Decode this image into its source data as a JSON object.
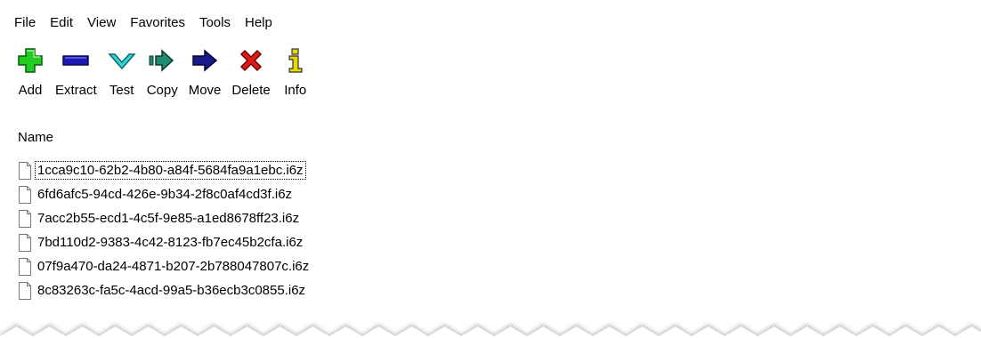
{
  "menu": {
    "items": [
      {
        "label": "File"
      },
      {
        "label": "Edit"
      },
      {
        "label": "View"
      },
      {
        "label": "Favorites"
      },
      {
        "label": "Tools"
      },
      {
        "label": "Help"
      }
    ]
  },
  "toolbar": {
    "add": {
      "label": "Add",
      "icon": "plus-icon",
      "color": "#22cc22"
    },
    "extract": {
      "label": "Extract",
      "icon": "minus-icon",
      "color": "#1a1ab0"
    },
    "test": {
      "label": "Test",
      "icon": "check-chevron-icon",
      "color": "#33d6d6"
    },
    "copy": {
      "label": "Copy",
      "icon": "double-arrow-right-icon",
      "color": "#1f8a6e"
    },
    "move": {
      "label": "Move",
      "icon": "arrow-right-icon",
      "color": "#1a1a8a"
    },
    "delete": {
      "label": "Delete",
      "icon": "x-icon",
      "color": "#e01818"
    },
    "info": {
      "label": "Info",
      "icon": "info-icon",
      "color": "#e6d800"
    }
  },
  "list": {
    "header": "Name",
    "files": [
      "1cca9c10-62b2-4b80-a84f-5684fa9a1ebc.i6z",
      "6fd6afc5-94cd-426e-9b34-2f8c0af4cd3f.i6z",
      "7acc2b55-ecd1-4c5f-9e85-a1ed8678ff23.i6z",
      "7bd110d2-9383-4c42-8123-fb7ec45b2cfa.i6z",
      "07f9a470-da24-4871-b207-2b788047807c.i6z",
      "8c83263c-fa5c-4acd-99a5-b36ecb3c0855.i6z"
    ]
  }
}
